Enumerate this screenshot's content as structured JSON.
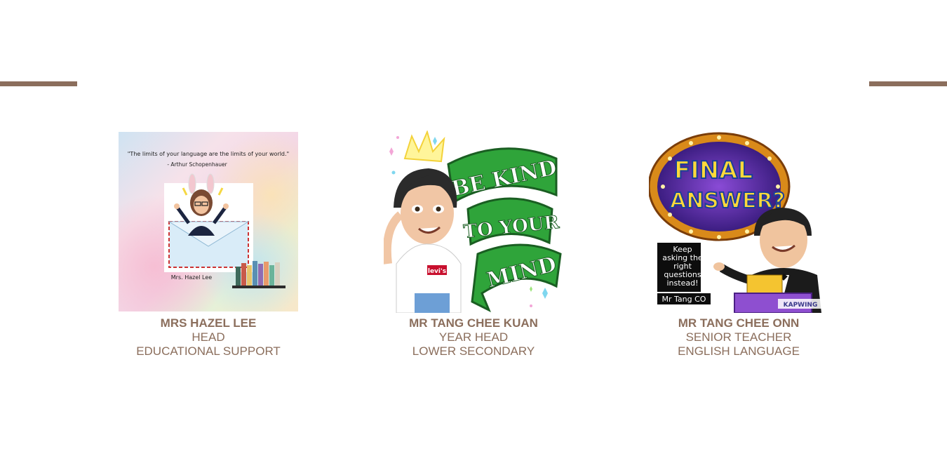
{
  "cards": [
    {
      "name": "MRS HAZEL LEE",
      "role": "HEAD",
      "department": "EDUCATIONAL SUPPORT",
      "image": {
        "quote": "\"The limits of your language are the limits of your world.\"",
        "quote_author": "- Arthur Schopenhauer",
        "signature": "Mrs. Hazel Lee"
      }
    },
    {
      "name": "MR TANG CHEE KUAN",
      "role": "YEAR HEAD",
      "department": "LOWER SECONDARY",
      "image": {
        "banner_line1": "BE KIND",
        "banner_line2": "TO YOUR",
        "banner_line3": "MIND",
        "shirt_logo": "levi's"
      }
    },
    {
      "name": "MR TANG CHEE ONN",
      "role": "SENIOR TEACHER",
      "department": "ENGLISH LANGUAGE",
      "image": {
        "sign_line1": "FINAL",
        "sign_line2": "ANSWER?",
        "speech": [
          "Keep",
          "asking the",
          "right",
          "questions",
          "instead!"
        ],
        "tag": "Mr Tang CO",
        "watermark": "KAPWING"
      }
    }
  ],
  "colors": {
    "accent": "#8b6e5c"
  }
}
